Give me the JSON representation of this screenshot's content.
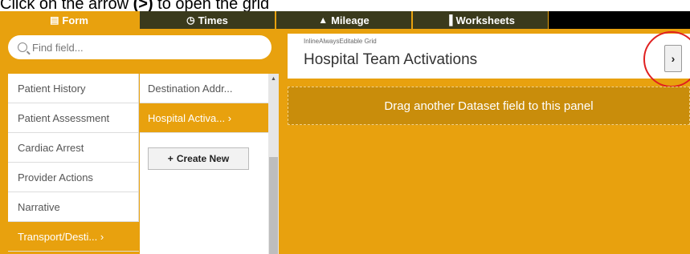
{
  "instruction": {
    "prefix": "Click on the arrow ",
    "arrow": "(>)",
    "suffix": " to open the grid"
  },
  "tabs": [
    {
      "label": "Form",
      "icon": "form-icon"
    },
    {
      "label": "Times",
      "icon": "clock-icon"
    },
    {
      "label": "Mileage",
      "icon": "road-icon"
    },
    {
      "label": "Worksheets",
      "icon": "document-icon"
    }
  ],
  "search": {
    "placeholder": "Find field..."
  },
  "sections": [
    "Patient History",
    "Patient Assessment",
    "Cardiac Arrest",
    "Provider Actions",
    "Narrative",
    "Transport/Desti... ›"
  ],
  "subsections": [
    "Destination Addr...",
    "Hospital Activa... ›"
  ],
  "create_new": "Create New",
  "panel": {
    "subtitle": "InlineAlwaysEditable Grid",
    "title": "Hospital Team Activations",
    "arrow": "›",
    "drop_text": "Drag another Dataset field to this panel"
  },
  "colors": {
    "accent": "#e8a10e",
    "highlight_circle": "#e02020"
  }
}
